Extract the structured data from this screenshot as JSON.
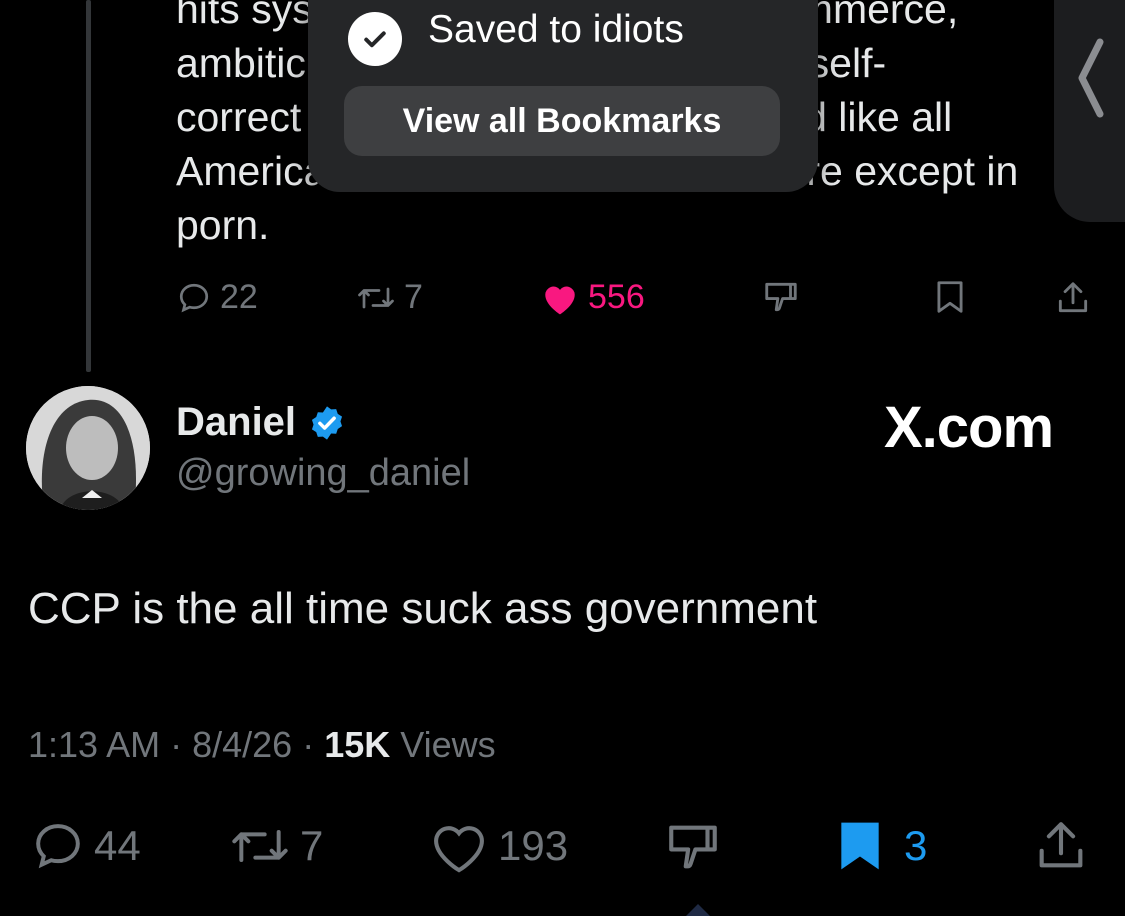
{
  "previous_tweet": {
    "lines": [
      {
        "left": "hits sys",
        "right": ", commerce,"
      },
      {
        "left": "ambitic",
        "right": ", self-"
      },
      {
        "left": "correct",
        "right": "ed like all"
      },
      {
        "left": "America",
        "right": "re except in"
      },
      {
        "left": "porn.",
        "right": ""
      }
    ],
    "replies": "22",
    "reposts": "7",
    "likes": "556",
    "like_color": "#f91880"
  },
  "toast": {
    "title": "Saved to idiots",
    "button_label": "View all Bookmarks"
  },
  "tweet": {
    "display_name": "Daniel",
    "verified": true,
    "handle": "@growing_daniel",
    "watermark": "X.com",
    "text": "CCP is the all time suck ass government",
    "time": "1:13 AM",
    "date": "8/4/26",
    "views_count": "15K",
    "views_label": "Views",
    "replies": "44",
    "reposts": "7",
    "likes": "193",
    "bookmarks": "3",
    "accent_color": "#1d9bf0"
  }
}
